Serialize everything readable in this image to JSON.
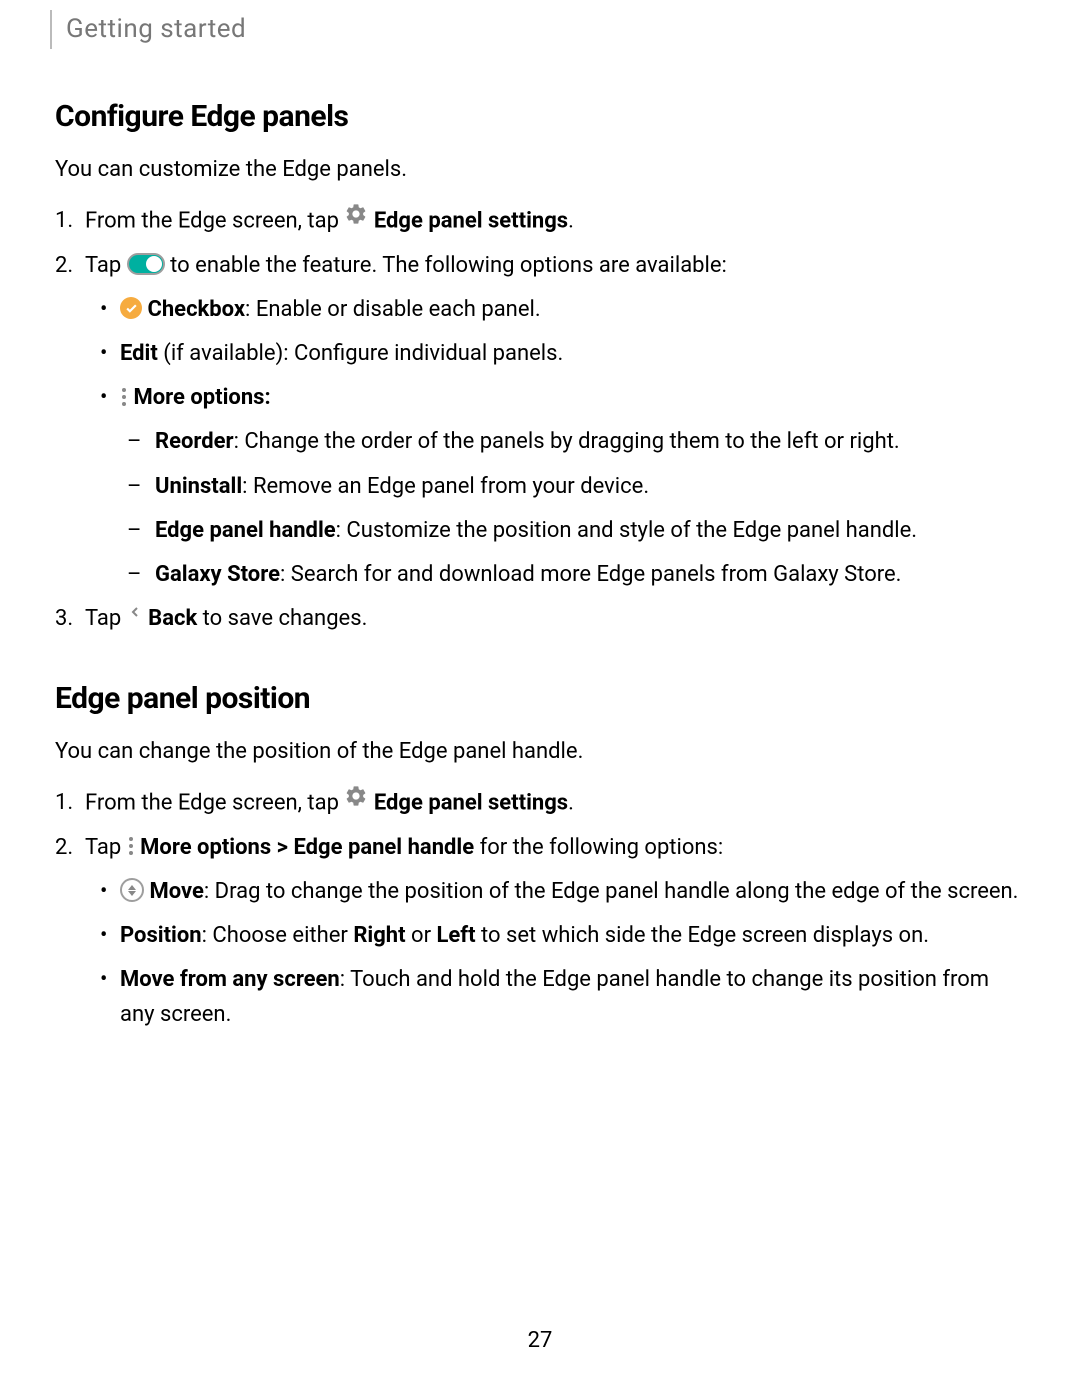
{
  "breadcrumb": "Getting started",
  "pageNumber": "27",
  "section1": {
    "heading": "Configure Edge panels",
    "intro": "You can customize the Edge panels.",
    "step1_pre": "From the Edge screen, tap ",
    "step1_bold": " Edge panel settings",
    "step1_post": ".",
    "step2_pre": "Tap ",
    "step2_post": " to enable the feature. The following options are available:",
    "bullet_checkbox_bold": " Checkbox",
    "bullet_checkbox_rest": ": Enable or disable each panel.",
    "bullet_edit_bold": "Edit",
    "bullet_edit_rest": " (if available): Configure individual panels.",
    "bullet_more_bold": " More options:",
    "dash_reorder_bold": "Reorder",
    "dash_reorder_rest": ": Change the order of the panels by dragging them to the left or right.",
    "dash_uninstall_bold": "Uninstall",
    "dash_uninstall_rest": ": Remove an Edge panel from your device.",
    "dash_handle_bold": "Edge panel handle",
    "dash_handle_rest": ": Customize the position and style of the Edge panel handle.",
    "dash_store_bold": "Galaxy Store",
    "dash_store_rest": ": Search for and download more Edge panels from Galaxy Store.",
    "step3_pre": "Tap ",
    "step3_bold": " Back",
    "step3_post": " to save changes."
  },
  "section2": {
    "heading": "Edge panel position",
    "intro": "You can change the position of the Edge panel handle.",
    "step1_pre": "From the Edge screen, tap ",
    "step1_bold": " Edge panel settings",
    "step1_post": ".",
    "step2_pre": "Tap ",
    "step2_bold1": " More options",
    "step2_gt": " > ",
    "step2_bold2": "Edge panel handle",
    "step2_post": " for the following options:",
    "bullet_move_bold": " Move",
    "bullet_move_rest": ": Drag to change the position of the Edge panel handle along the edge of the screen.",
    "bullet_pos_bold": "Position",
    "bullet_pos_mid1": ": Choose either ",
    "bullet_pos_right": "Right",
    "bullet_pos_or": " or ",
    "bullet_pos_left": "Left",
    "bullet_pos_end": " to set which side the Edge screen displays on.",
    "bullet_any_bold": "Move from any screen",
    "bullet_any_rest": ": Touch and hold the Edge panel handle to change its position from any screen."
  }
}
